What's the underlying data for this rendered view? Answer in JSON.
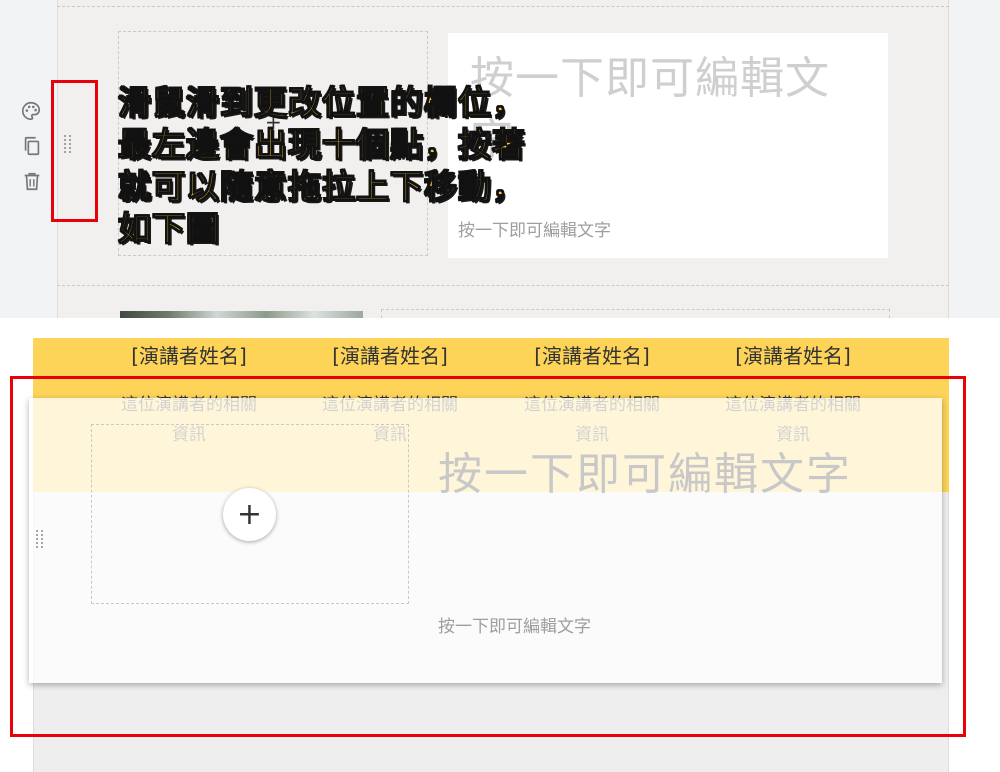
{
  "top_panel": {
    "text_block": {
      "heading": "按一下即可編輯文字",
      "body": "按一下即可編輯文字"
    },
    "toolbar": {
      "palette_icon": "palette-icon",
      "copy_icon": "copy-icon",
      "trash_icon": "trash-icon",
      "drag_handle_icon": "drag-handle-icon"
    },
    "annotation": {
      "lines": [
        "滑鼠滑到更改位置的欄位，",
        "最左邊會出現十個點，按著",
        "就可以隨意拖拉上下移動，",
        "如下圖"
      ],
      "text_color": "#fecc33",
      "highlight_color": "#e8000b"
    }
  },
  "bottom_panel": {
    "band_color": "#fdd458",
    "speakers": [
      {
        "name": "[演講者姓名]",
        "info_line1": "這位演講者的相關",
        "info_line2": "資訊"
      },
      {
        "name": "[演講者姓名]",
        "info_line1": "這位演講者的相關",
        "info_line2": "資訊"
      },
      {
        "name": "[演講者姓名]",
        "info_line1": "這位演講者的相關",
        "info_line2": "資訊"
      },
      {
        "name": "[演講者姓名]",
        "info_line1": "這位演講者的相關",
        "info_line2": "資訊"
      }
    ],
    "dragged_block": {
      "add_button_label": "+",
      "heading": "按一下即可編輯文字",
      "body": "按一下即可編輯文字"
    }
  }
}
